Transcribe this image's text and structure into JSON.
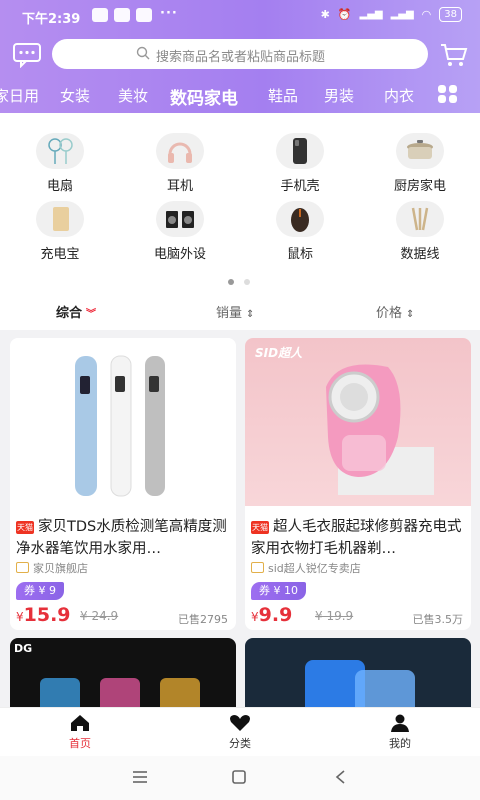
{
  "status": {
    "time": "下午2:39",
    "dots": "···",
    "battery": "38"
  },
  "search": {
    "placeholder": "搜索商品名或者粘贴商品标题"
  },
  "categories": [
    "家日用",
    "女装",
    "美妆",
    "数码家电",
    "鞋品",
    "男装",
    "内衣"
  ],
  "active_category": "数码家电",
  "subcategories": [
    {
      "label": "电扇",
      "icon": "fan-icon"
    },
    {
      "label": "耳机",
      "icon": "headphones-icon"
    },
    {
      "label": "手机壳",
      "icon": "phone-case-icon"
    },
    {
      "label": "厨房家电",
      "icon": "cooker-icon"
    },
    {
      "label": "充电宝",
      "icon": "power-bank-icon"
    },
    {
      "label": "电脑外设",
      "icon": "speakers-icon"
    },
    {
      "label": "鼠标",
      "icon": "mouse-icon"
    },
    {
      "label": "数据线",
      "icon": "cable-icon"
    }
  ],
  "sort": {
    "default": "综合",
    "sales": "销量",
    "price": "价格"
  },
  "products": [
    {
      "title": "家贝TDS水质检测笔高精度测净水器笔饮用水家用…",
      "shop": "家贝旗舰店",
      "coupon": "券 ¥ 9",
      "currency": "¥",
      "price": "15.9",
      "original": "¥ 24.9",
      "sold": "已售2795",
      "tag": "天猫"
    },
    {
      "title": "超人毛衣服起球修剪器充电式家用衣物打毛机器剃…",
      "shop": "sid超人锐亿专卖店",
      "coupon": "券 ¥ 10",
      "currency": "¥",
      "price": "9.9",
      "original": "¥ 19.9",
      "sold": "已售3.5万",
      "tag": "天猫",
      "brand_logo": "SID超人"
    }
  ],
  "teaser_logo": "DG",
  "nav": {
    "home": "首页",
    "category": "分类",
    "mine": "我的"
  },
  "colors": {
    "accent": "#e6303a",
    "header_start": "#b58ef0",
    "header_end": "#b7a1f5",
    "coupon": "#9d6ef0"
  }
}
